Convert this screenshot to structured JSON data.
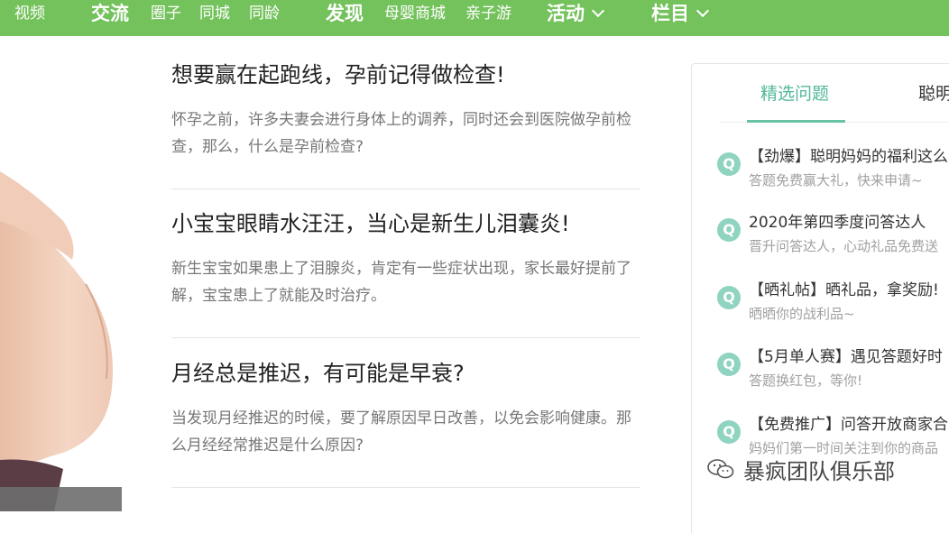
{
  "topnav": {
    "video": "视频",
    "communication": "交流",
    "circle": "圈子",
    "same_city": "同城",
    "same_age": "同龄",
    "discover": "发现",
    "mall": "母婴商城",
    "parent_child_travel": "亲子游",
    "activities": "活动",
    "columns": "栏目"
  },
  "articles": [
    {
      "title": "想要赢在起跑线，孕前记得做检查!",
      "desc": "怀孕之前，许多夫妻会进行身体上的调养，同时还会到医院做孕前检查，那么，什么是孕前检查?"
    },
    {
      "title": "小宝宝眼睛水汪汪，当心是新生儿泪囊炎!",
      "desc": "新生宝宝如果患上了泪腺炎，肯定有一些症状出现，家长最好提前了解，宝宝患上了就能及时治疗。"
    },
    {
      "title": "月经总是推迟，有可能是早衰?",
      "desc": "当发现月经推迟的时候，要了解原因早日改善，以免会影响健康。那么月经经常推迟是什么原因?"
    }
  ],
  "panel": {
    "tab_active": "精选问题",
    "tab_other": "聪明",
    "badge": "Q",
    "questions": [
      {
        "title": "【劲爆】聪明妈妈的福利这么",
        "sub": "答题免费赢大礼，快来申请~"
      },
      {
        "title": "2020年第四季度问答达人",
        "sub": "晋升问答达人，心动礼品免费送"
      },
      {
        "title": "【晒礼帖】晒礼品，拿奖励!",
        "sub": "晒晒你的战利品~"
      },
      {
        "title": "【5月单人赛】遇见答题好时",
        "sub": "答题换红包，等你!"
      },
      {
        "title": "【免费推广】问答开放商家合",
        "sub": "妈妈们第一时间关注到你的商品"
      }
    ]
  },
  "watermark": {
    "text": "暴疯团队俱乐部"
  },
  "colors": {
    "nav_bg": "#74c25c",
    "accent": "#52b79a",
    "badge": "#8fd3c1"
  }
}
